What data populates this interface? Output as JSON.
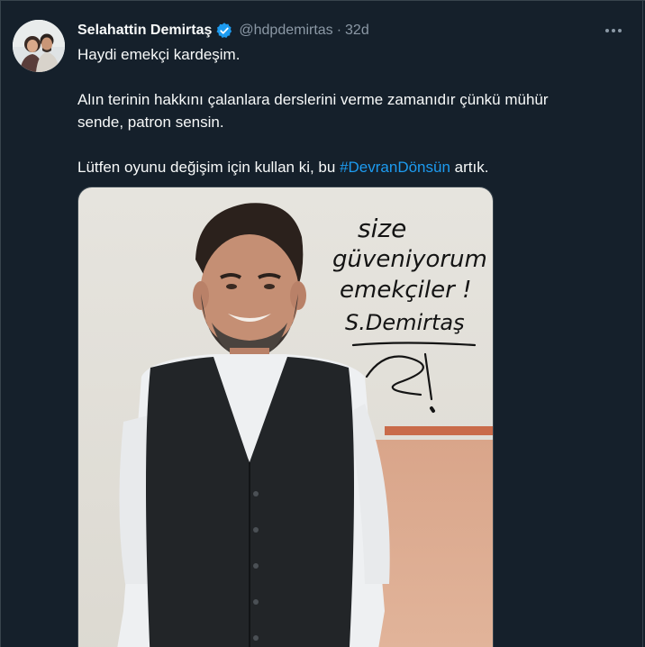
{
  "tweet": {
    "author_name": "Selahattin Demirtaş",
    "handle": "@hdpdemirtas",
    "separator": "·",
    "time": "32d",
    "text_line1": "Haydi emekçi kardeşim.",
    "text_line2": "Alın terinin hakkını çalanlara derslerini verme zamanıdır çünkü mühür",
    "text_line3": "sende, patron sensin.",
    "text_line4_before": "Lütfen oyunu değişim için kullan ki, bu ",
    "hashtag": "#DevranDönsün",
    "text_line4_after": " artık.",
    "verified": true
  },
  "media": {
    "handwritten_note": [
      "size",
      "güveniyorum",
      "emekçiler !",
      "S.Demirtaş"
    ]
  },
  "colors": {
    "background": "#15202b",
    "text": "#f7f9f9",
    "secondary": "#8b98a5",
    "accent": "#1d9bf0",
    "border": "#38444d"
  },
  "icons": {
    "verified": "verified-badge-icon",
    "more": "more-options-icon"
  }
}
